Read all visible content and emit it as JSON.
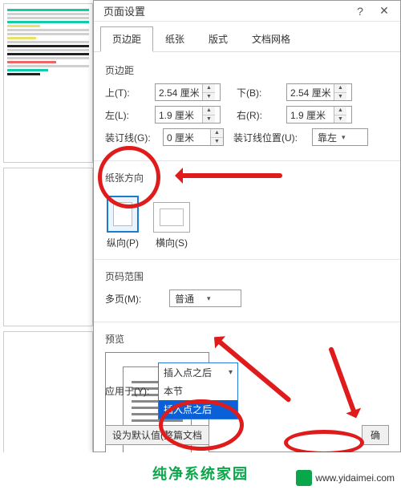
{
  "dialog": {
    "title": "页面设置",
    "help_glyph": "?",
    "close_glyph": "✕",
    "tabs": [
      "页边距",
      "纸张",
      "版式",
      "文档网格"
    ],
    "margins": {
      "heading": "页边距",
      "top_label": "上(T):",
      "top_value": "2.54 厘米",
      "bottom_label": "下(B):",
      "bottom_value": "2.54 厘米",
      "left_label": "左(L):",
      "left_value": "1.9 厘米",
      "right_label": "右(R):",
      "right_value": "1.9 厘米",
      "gutter_label": "装订线(G):",
      "gutter_value": "0 厘米",
      "gutter_pos_label": "装订线位置(U):",
      "gutter_pos_value": "靠左"
    },
    "orientation": {
      "heading": "纸张方向",
      "portrait": "纵向(P)",
      "landscape": "横向(S)"
    },
    "pages": {
      "heading": "页码范围",
      "multi_label": "多页(M):",
      "multi_value": "普通"
    },
    "preview": {
      "heading": "预览"
    },
    "apply": {
      "label": "应用于(Y):",
      "selected": "插入点之后",
      "options": [
        "本节",
        "插入点之后"
      ]
    },
    "buttons": {
      "default": "设为默认值(整篇文档",
      "ok_partial": "确"
    }
  },
  "footer": {
    "brand": "纯净系统家园",
    "site": "www.yidaimei.com"
  }
}
